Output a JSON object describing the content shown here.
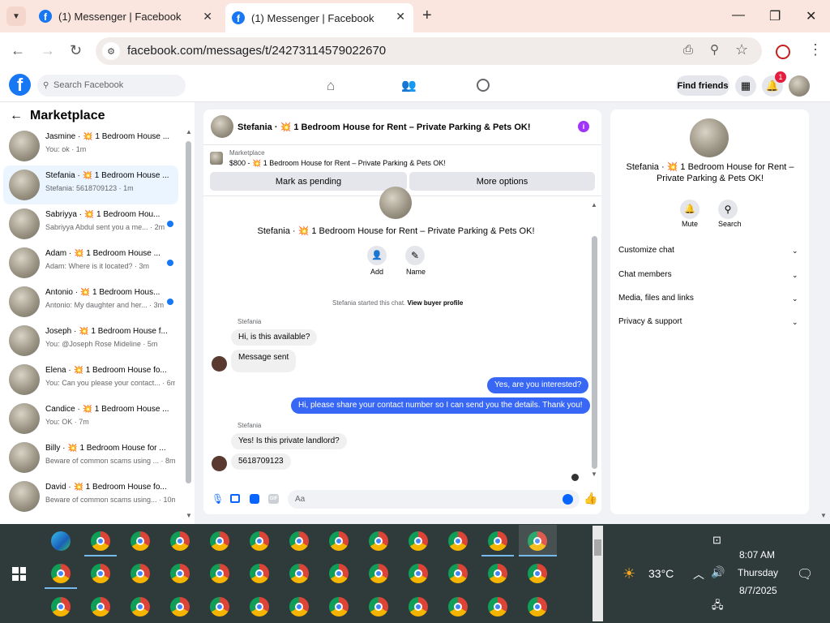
{
  "browser": {
    "tabs": [
      {
        "title": "(1) Messenger | Facebook"
      },
      {
        "title": "(1) Messenger | Facebook"
      }
    ],
    "url": "facebook.com/messages/t/24273114579022670"
  },
  "fb": {
    "logo": "f",
    "search_placeholder": "Search Facebook",
    "find_friends": "Find friends",
    "notif_count": "1"
  },
  "left": {
    "title": "Marketplace",
    "chats": [
      {
        "name": "Jasmine · 💥 1 Bedroom House ...",
        "preview": "You: ok · 1m"
      },
      {
        "name": "Stefania · 💥 1 Bedroom House ...",
        "preview": "Stefania: 5618709123 · 1m"
      },
      {
        "name": "Sabriyya · 💥 1 Bedroom Hou...",
        "preview": "Sabriyya Abdul sent you a me... · 2m"
      },
      {
        "name": "Adam · 💥 1 Bedroom House ...",
        "preview": "Adam: Where is it located? · 3m"
      },
      {
        "name": "Antonio · 💥 1 Bedroom Hous...",
        "preview": "Antonio: My daughter and her... · 3m"
      },
      {
        "name": "Joseph · 💥 1 Bedroom House f...",
        "preview": "You: @Joseph Rose Mideline · 5m"
      },
      {
        "name": "Elena · 💥 1 Bedroom House fo...",
        "preview": "You: Can you please your contact... · 6m"
      },
      {
        "name": "Candice · 💥 1 Bedroom House ...",
        "preview": "You: OK · 7m"
      },
      {
        "name": "Billy · 💥 1 Bedroom House for ...",
        "preview": "Beware of common scams using ... · 8m"
      },
      {
        "name": "David · 💥 1 Bedroom House fo...",
        "preview": "Beware of common scams using... · 10m"
      }
    ]
  },
  "chat": {
    "header": "Stefania · 💥 1 Bedroom House for Rent – Private Parking & Pets OK!",
    "marketplace_label": "Marketplace",
    "listing": "$800 - 💥 1 Bedroom House for Rent – Private Parking & Pets OK!",
    "mark_pending": "Mark as pending",
    "more_options": "More options",
    "profile_title": "Stefania · 💥 1 Bedroom House for Rent – Private Parking & Pets OK!",
    "add_label": "Add",
    "name_label": "Name",
    "started_text": "Stefania started this chat.",
    "view_buyer": "View buyer profile",
    "sender": "Stefania",
    "messages": [
      "Hi, is this available?",
      "Message sent",
      "Yes, are you interested?",
      "Hi, please share your contact number so I can send you the details. Thank you!",
      "Yes! Is this private landlord?",
      "5618709123"
    ],
    "input_placeholder": "Aa"
  },
  "right": {
    "title": "Stefania · 💥 1 Bedroom House for Rent – Private Parking & Pets OK!",
    "mute": "Mute",
    "search": "Search",
    "sections": [
      "Customize chat",
      "Chat members",
      "Media, files and links",
      "Privacy & support"
    ]
  },
  "taskbar": {
    "temperature": "33°C",
    "time": "8:07 AM",
    "day": "Thursday",
    "date": "8/7/2025"
  }
}
